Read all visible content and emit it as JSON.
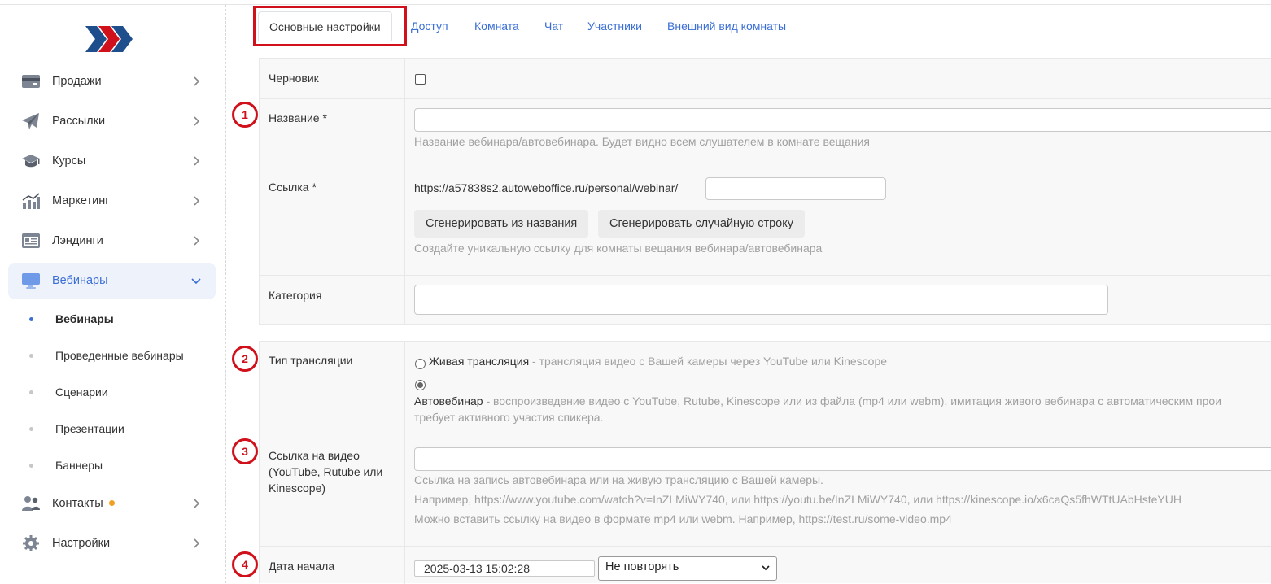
{
  "sidebar": {
    "items": [
      {
        "label": "Продажи",
        "icon": "card-icon"
      },
      {
        "label": "Рассылки",
        "icon": "paper-plane-icon"
      },
      {
        "label": "Курсы",
        "icon": "graduation-cap-icon"
      },
      {
        "label": "Маркетинг",
        "icon": "bar-chart-icon"
      },
      {
        "label": "Лэндинги",
        "icon": "landing-page-icon"
      },
      {
        "label": "Вебинары",
        "icon": "monitor-icon"
      },
      {
        "label": "Контакты",
        "icon": "users-icon"
      },
      {
        "label": "Настройки",
        "icon": "gear-icon"
      }
    ],
    "subitems": [
      {
        "label": "Вебинары"
      },
      {
        "label": "Проведенные вебинары"
      },
      {
        "label": "Сценарии"
      },
      {
        "label": "Презентации"
      },
      {
        "label": "Баннеры"
      }
    ]
  },
  "tabs": [
    {
      "label": "Основные настройки"
    },
    {
      "label": "Доступ"
    },
    {
      "label": "Комната"
    },
    {
      "label": "Чат"
    },
    {
      "label": "Участники"
    },
    {
      "label": "Внешний вид комнаты"
    }
  ],
  "form": {
    "draft_label": "Черновик",
    "name_label": "Название *",
    "name_value": "",
    "name_hint": "Название вебинара/автовебинара. Будет видно всем слушателем в комнате вещания",
    "link_label": "Ссылка *",
    "link_prefix": "https://a57838s2.autoweboffice.ru/personal/webinar/",
    "link_value": "",
    "gen_from_name": "Сгенерировать из названия",
    "gen_random": "Сгенерировать случайную строку",
    "link_hint": "Создайте уникальную ссылку для комнаты вещания вебинара/автовебинара",
    "category_label": "Категория",
    "category_value": "",
    "broadcast_label": "Тип трансляции",
    "live_title": "Живая трансляция",
    "live_desc": " - трансляция видео с Вашей камеры через YouTube или Kinescope",
    "auto_title": "Автовебинар",
    "auto_desc": " - воспроизведение видео с YouTube, Rutube, Kinescope или из файла (mp4 или webm), имитация живого вебинара с автоматическим прои",
    "auto_desc2": "требует активного участия спикера.",
    "video_label_1": "Ссылка на видео",
    "video_label_2": "(YouTube, Rutube или",
    "video_label_3": "Kinescope)",
    "video_value": "",
    "video_hint_1": "Ссылка на запись автовебинара или на живую трансляцию с Вашей камеры.",
    "video_hint_2": "Например, https://www.youtube.com/watch?v=InZLMiWY740, или https://youtu.be/InZLMiWY740, или https://kinescope.io/x6caQs5fhWTtUAbHsteYUH",
    "video_hint_3": "Можно вставить ссылку на видео в формате mp4 или webm. Например, https://test.ru/some-video.mp4",
    "start_label": "Дата начала",
    "start_value": "2025-03-13 15:02:28",
    "repeat_value": "Не повторять"
  },
  "markers": [
    "1",
    "2",
    "3",
    "4"
  ],
  "colors": {
    "accent": "#3b6fd6",
    "annotation": "#d0101a",
    "logo_red": "#d0101a",
    "logo_blue": "#1f4e8c"
  }
}
